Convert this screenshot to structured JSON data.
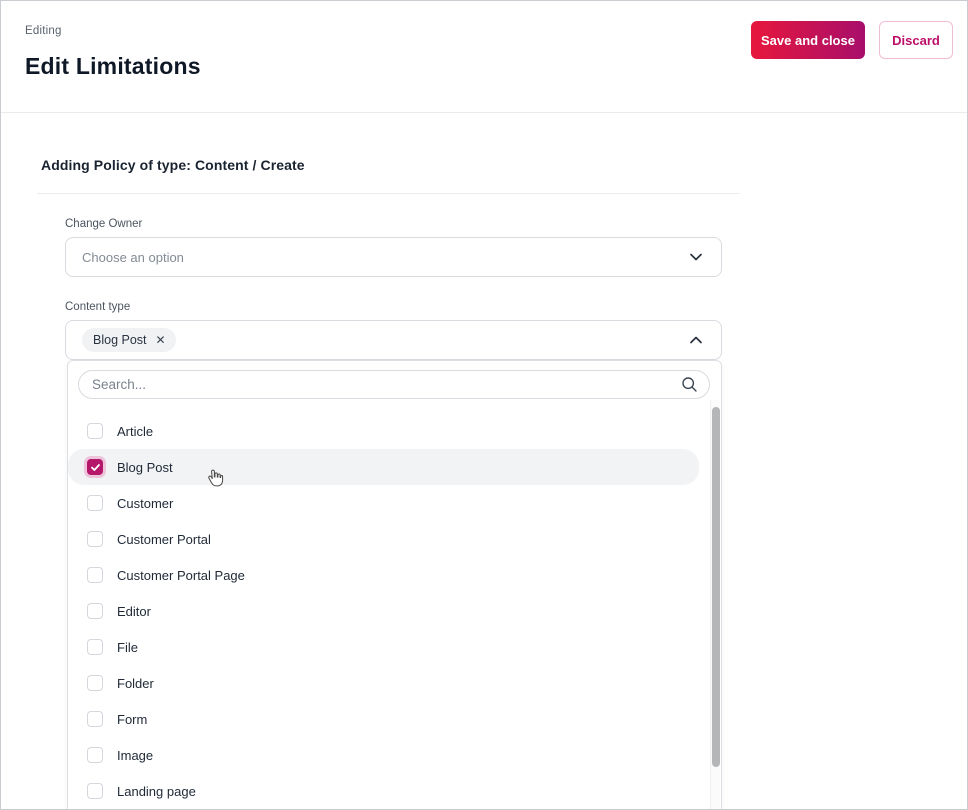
{
  "header": {
    "eyebrow": "Editing",
    "title": "Edit Limitations",
    "save_label": "Save and close",
    "discard_label": "Discard"
  },
  "form": {
    "section_title": "Adding Policy of type: Content / Create",
    "change_owner": {
      "label": "Change Owner",
      "placeholder": "Choose an option"
    },
    "content_type": {
      "label": "Content type",
      "selected_chip": "Blog Post",
      "chip_remove": "✕"
    }
  },
  "dropdown": {
    "search_placeholder": "Search...",
    "options": [
      {
        "label": "Article",
        "checked": false
      },
      {
        "label": "Blog Post",
        "checked": true
      },
      {
        "label": "Customer",
        "checked": false
      },
      {
        "label": "Customer Portal",
        "checked": false
      },
      {
        "label": "Customer Portal Page",
        "checked": false
      },
      {
        "label": "Editor",
        "checked": false
      },
      {
        "label": "File",
        "checked": false
      },
      {
        "label": "Folder",
        "checked": false
      },
      {
        "label": "Form",
        "checked": false
      },
      {
        "label": "Image",
        "checked": false
      },
      {
        "label": "Landing page",
        "checked": false
      }
    ]
  },
  "colors": {
    "accent_gradient_start": "#e7173c",
    "accent_gradient_end": "#a80e6b",
    "accent": "#b5176b",
    "discard_text": "#bd0f6a",
    "row_highlight": "#f2f3f5",
    "title_text": "#0f1826"
  }
}
